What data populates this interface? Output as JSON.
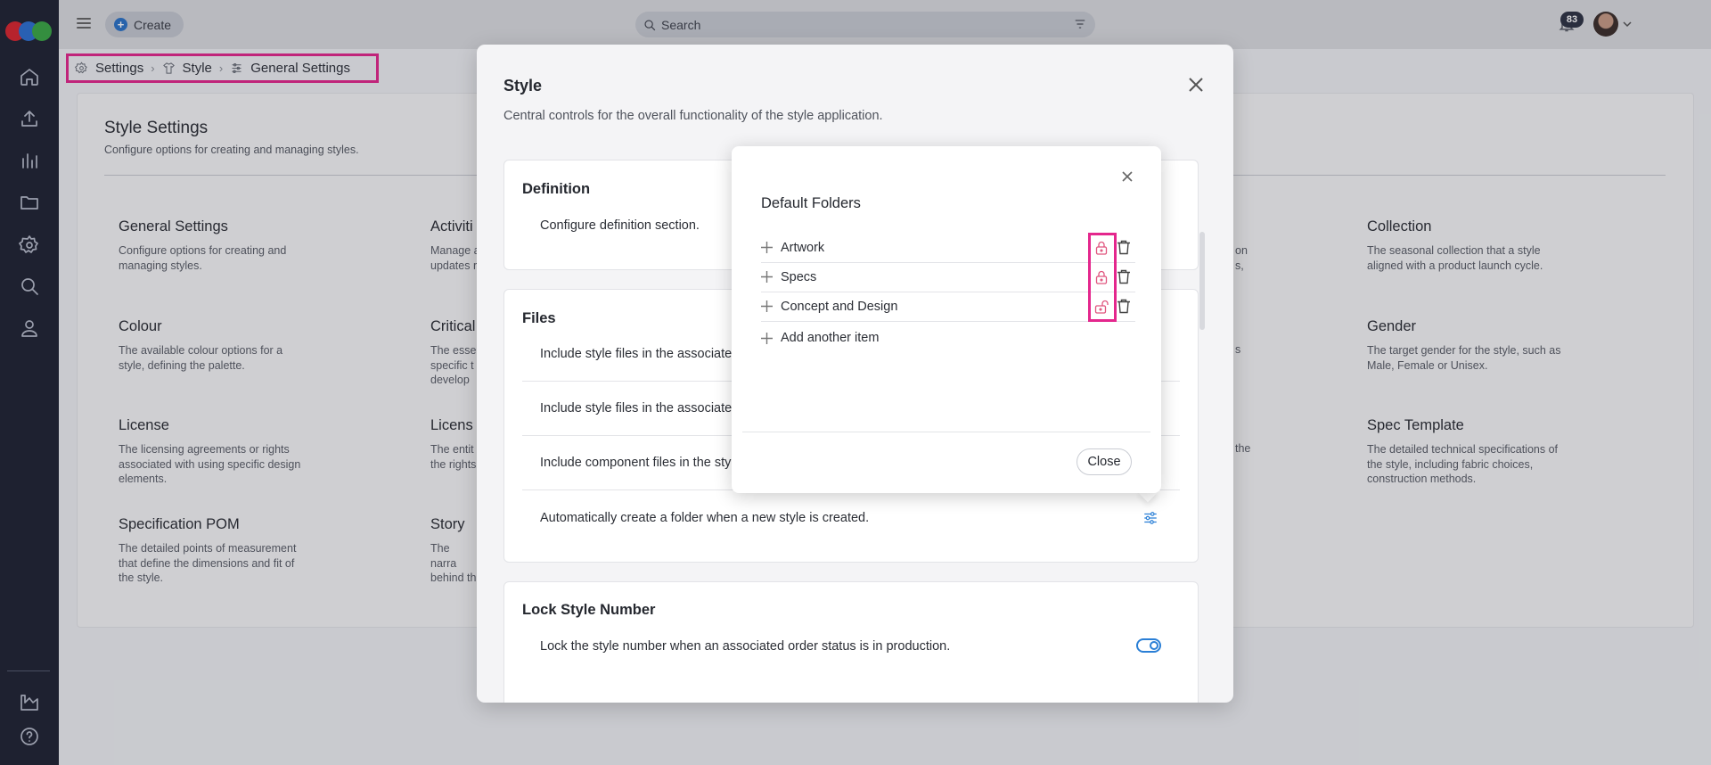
{
  "topbar": {
    "create_label": "Create",
    "search_placeholder": "Search",
    "notification_count": "83"
  },
  "breadcrumb": {
    "items": [
      "Settings",
      "Style",
      "General Settings"
    ]
  },
  "settings": {
    "title": "Style Settings",
    "subtitle": "Configure options for creating and managing styles.",
    "cards": [
      {
        "title": "General Settings",
        "desc": "Configure options for creating and managing styles."
      },
      {
        "title": "Activiti",
        "desc": "Manage a updates r"
      },
      {
        "title": "Collection",
        "desc": "The seasonal collection that a style aligned with a product launch cycle."
      },
      {
        "title": "Colour",
        "desc": "The available colour options for a style, defining the palette."
      },
      {
        "title": "Critical",
        "desc": "The esse specific t develop"
      },
      {
        "title": "Gender",
        "desc": "The target gender for the style, such as Male, Female or Unisex."
      },
      {
        "title": "License",
        "desc": "The licensing agreements or rights associated with using specific design elements."
      },
      {
        "title": "Licens",
        "desc": "The entit the rights"
      },
      {
        "title": "Spec Template",
        "desc": "The detailed technical specifications of the style, including fabric choices, construction methods."
      },
      {
        "title": "Specification POM",
        "desc": "The detailed points of measurement that define the dimensions and fit of the style."
      },
      {
        "title": "Story",
        "desc": "The narra behind th"
      }
    ],
    "cut_fragments": [
      "on",
      "s,",
      "s",
      "the"
    ]
  },
  "modal": {
    "title": "Style",
    "description": "Central controls for the overall functionality of the style application.",
    "definition": {
      "title": "Definition",
      "row": "Configure definition section."
    },
    "files": {
      "title": "Files",
      "rows": [
        "Include style files in the associate",
        "Include style files in the associate",
        "Include component files in the sty",
        "Automatically create a folder when a new style is created."
      ]
    },
    "lock_style": {
      "title": "Lock Style Number",
      "row": "Lock the style number when an associated order status is in production."
    }
  },
  "popover": {
    "title": "Default Folders",
    "folders": [
      {
        "name": "Artwork",
        "lock_icon": "lock-closed"
      },
      {
        "name": "Specs",
        "lock_icon": "lock-closed"
      },
      {
        "name": "Concept and Design",
        "lock_icon": "lock-open"
      }
    ],
    "add_item_label": "Add another item",
    "close_label": "Close"
  },
  "colors": {
    "highlight": "#e4278d",
    "accent": "#2a7fd6",
    "sidebar": "#1f2333",
    "lock_icon": "#e0557e"
  }
}
